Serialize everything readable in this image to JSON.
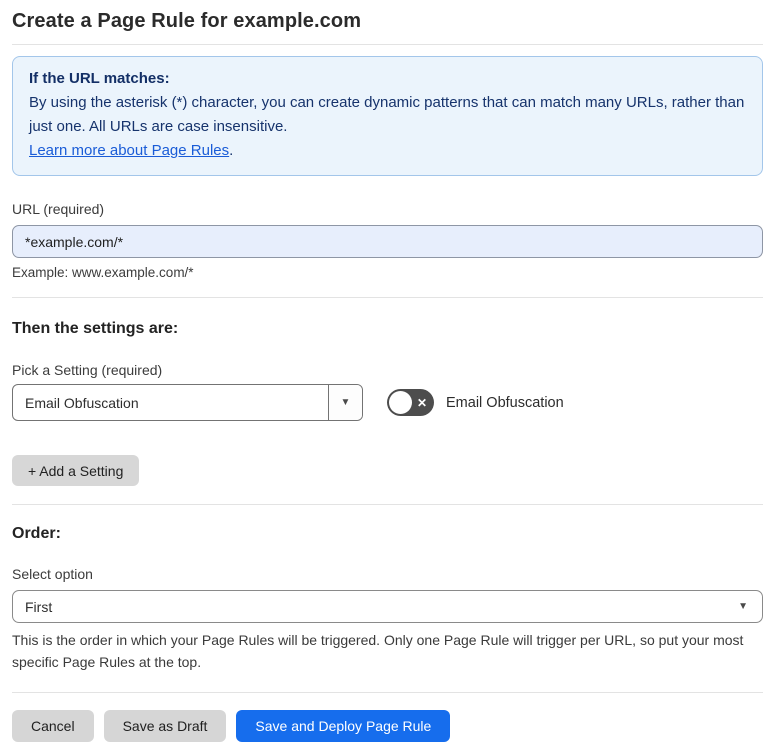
{
  "page": {
    "title": "Create a Page Rule for example.com"
  },
  "info_box": {
    "heading": "If the URL matches:",
    "body": "By using the asterisk (*) character, you can create dynamic patterns that can match many URLs, rather than just one. All URLs are case insensitive.",
    "link_label": "Learn more about Page Rules",
    "link_suffix": "."
  },
  "url_section": {
    "label": "URL (required)",
    "value": "*example.com/*",
    "example": "Example: www.example.com/*"
  },
  "settings_section": {
    "heading": "Then the settings are:",
    "pick_label": "Pick a Setting (required)",
    "selected_setting": "Email Obfuscation",
    "toggle_label": "Email Obfuscation",
    "toggle_state": "off",
    "add_button_label": "+ Add a Setting"
  },
  "order_section": {
    "heading": "Order:",
    "select_label": "Select option",
    "selected_option": "First",
    "help_text": "This is the order in which your Page Rules will be triggered. Only one Page Rule will trigger per URL, so put your most specific Page Rules at the top."
  },
  "footer": {
    "cancel_label": "Cancel",
    "save_draft_label": "Save as Draft",
    "save_deploy_label": "Save and Deploy Page Rule"
  },
  "icons": {
    "dropdown_arrow": "▼",
    "toggle_x": "✕"
  },
  "colors": {
    "accent_blue": "#166ded",
    "info_bg": "#ebf4fc",
    "info_border": "#a3c6ea",
    "info_text": "#16336c",
    "link_blue": "#1a5cd7",
    "input_bg": "#e7eefc",
    "toggle_off_bg": "#4d4d4d",
    "button_gray": "#d6d6d6"
  }
}
